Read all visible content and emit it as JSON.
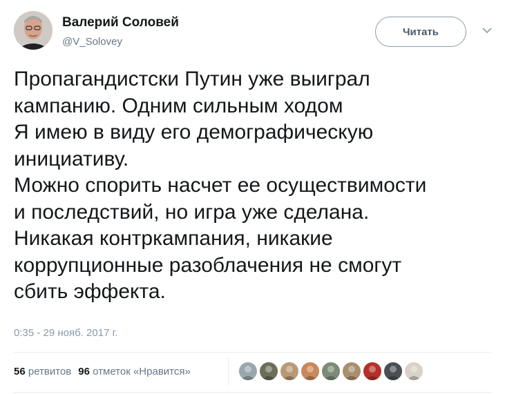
{
  "author": {
    "display_name": "Валерий Соловей",
    "handle": "@V_Solovey",
    "avatar_icon": "user-photo"
  },
  "follow_button": {
    "label": "Читать"
  },
  "menu_icon": "chevron-down-icon",
  "tweet": {
    "text": "Пропагандистски Путин уже выиграл\nкампанию. Одним сильным ходом\nЯ имею в виду его демографическую\nинициативу.\nМожно спорить насчет ее осуществимости\nи последствий, но игра уже сделана.\nНикакая контркампания, никакие\nкоррупционные разоблачения не смогут\nсбить эффекта.",
    "timestamp": "0:35 - 29 нояб. 2017 г."
  },
  "stats": {
    "retweets_count": "56",
    "retweets_label": "ретвитов",
    "likes_count": "96",
    "likes_label": "отметок «Нравится»"
  },
  "likers": [
    {
      "color": "#9aa6ad"
    },
    {
      "color": "#6b6f5a"
    },
    {
      "color": "#b69a76"
    },
    {
      "color": "#c8885a"
    },
    {
      "color": "#7c8a78"
    },
    {
      "color": "#a98f6e"
    },
    {
      "color": "#b5302a"
    },
    {
      "color": "#4b4f55"
    },
    {
      "color": "#d8d3c8"
    }
  ]
}
